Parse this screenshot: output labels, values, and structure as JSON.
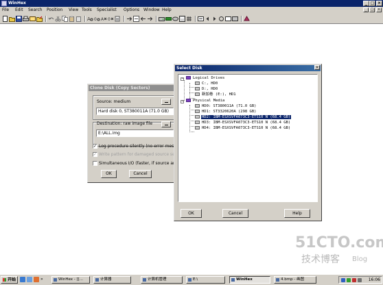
{
  "app": {
    "title": "WinHex",
    "menu": [
      "File",
      "Edit",
      "Search",
      "Position",
      "View",
      "Tools",
      "Specialist",
      "Options",
      "Window",
      "Help"
    ],
    "window_buttons": [
      "_",
      "□",
      "×"
    ],
    "mdi_buttons": [
      "_",
      "□",
      "×"
    ]
  },
  "toolbar": {
    "icons": [
      "new-file-icon",
      "open-file-icon",
      "save-icon",
      "print-icon",
      "properties-icon",
      "open-folder-icon",
      "undo-icon",
      "cut-icon",
      "copy-icon",
      "paste-icon",
      "paste-special-icon",
      "find-text-icon",
      "find-hex-icon",
      "replace-text-icon",
      "replace-hex-icon",
      "find-again-icon",
      "goto-offset-icon",
      "back-icon",
      "forward-icon",
      "goto-icon",
      "open-disk-icon",
      "ram-editor-icon",
      "disk-editor-icon",
      "calculator-icon",
      "hash-icon",
      "next-icon",
      "prev-icon",
      "first-icon",
      "last-icon",
      "view-icon",
      "info-icon"
    ]
  },
  "clone_dialog": {
    "title": "Clone Disk (Copy Sectors)",
    "source_label": "Source: medium",
    "source_value": "Hard disk 0, ST380011A (71.0 GB)",
    "dest_label": "Destination: raw image file",
    "dest_value": "E:\\ALL.img",
    "options": [
      {
        "label": "Log procedure silently (no error messages)",
        "checked": true,
        "enabled": true
      },
      {
        "label": "Write pattern for damaged source sectors",
        "checked": true,
        "enabled": false
      },
      {
        "label": "Simultaneous I/O (faster, if source and des",
        "checked": false,
        "enabled": true
      }
    ],
    "ok_label": "OK",
    "cancel_label": "Cancel"
  },
  "select_disk": {
    "title": "Select Disk",
    "close_label": "×",
    "logical_header": "Logical Drives",
    "logical": [
      "C:, HD0",
      "D:, HD0",
      "新加卷 (E:), HD1"
    ],
    "physical_header": "Physical Media",
    "physical": [
      {
        "label": "HD0:  ST380011A (71.0 GB)",
        "selected": false
      },
      {
        "label": "HD1:  ST3320620A (298 GB)",
        "selected": false
      },
      {
        "label": "HD2:  IBM-ESXSVFA073C3-ETS10 N (68.4 GB)",
        "selected": true
      },
      {
        "label": "HD3:  IBM-ESXSVFA073C3-ETS10 N (68.4 GB)",
        "selected": false
      },
      {
        "label": "HD4:  IBM-ESXSVFA073C3-ETS10 N (68.4 GB)",
        "selected": false
      }
    ],
    "ok_label": "OK",
    "cancel_label": "Cancel",
    "help_label": "Help"
  },
  "watermark": {
    "line1": "51CTO.com",
    "line2": "技术博客",
    "line3": "Blog"
  },
  "taskbar": {
    "start_label": "开始",
    "tasks": [
      {
        "label": "WinHex - [[...",
        "active": false
      },
      {
        "label": "计算器",
        "active": false
      },
      {
        "label": "计算机管理",
        "active": false
      },
      {
        "label": "E:\\",
        "active": false
      },
      {
        "label": "WinHex",
        "active": true
      },
      {
        "label": "4.bmp - 画图",
        "active": false
      }
    ],
    "clock": "16:06"
  }
}
